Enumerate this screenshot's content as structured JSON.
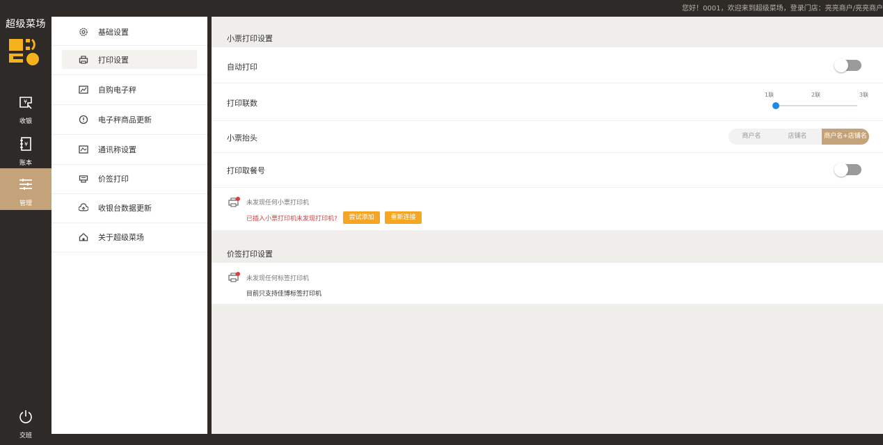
{
  "header": {
    "welcome": "您好！0001，欢迎来到超级菜场，登录门店：亮亮商户/亮亮商户"
  },
  "rail": {
    "brand": "超级菜场",
    "items": [
      {
        "label": "收银",
        "icon": "cashier-icon"
      },
      {
        "label": "账本",
        "icon": "ledger-icon"
      },
      {
        "label": "管理",
        "icon": "sliders-icon"
      }
    ],
    "logout": {
      "label": "交班",
      "icon": "power-icon"
    }
  },
  "menu": {
    "items": [
      {
        "label": "基础设置",
        "icon": "gear-icon"
      },
      {
        "label": "打印设置",
        "icon": "printer-icon"
      },
      {
        "label": "自购电子秤",
        "icon": "scale-icon"
      },
      {
        "label": "电子秤商品更新",
        "icon": "update-icon"
      },
      {
        "label": "通讯称设置",
        "icon": "comm-scale-icon"
      },
      {
        "label": "价签打印",
        "icon": "label-printer-icon"
      },
      {
        "label": "收银台数据更新",
        "icon": "cloud-upload-icon"
      },
      {
        "label": "关于超级菜场",
        "icon": "home-icon"
      }
    ],
    "selected": "打印设置"
  },
  "receipt_section": {
    "title": "小票打印设置",
    "auto_print": {
      "label": "自动打印",
      "on": false
    },
    "copies": {
      "label": "打印联数",
      "options": [
        "1联",
        "2联",
        "3联"
      ],
      "value": "1联"
    },
    "header": {
      "label": "小票抬头",
      "options": [
        "商户名",
        "店铺名",
        "商户名+店铺名"
      ],
      "selected": "商户名+店铺名"
    },
    "pickup_no": {
      "label": "打印取餐号",
      "on": false
    },
    "status": "未发现任何小票打印机",
    "warning": "已插入小票打印机未发现打印机?",
    "try_add": "尝试添加",
    "reconnect": "重新连接"
  },
  "label_section": {
    "title": "价签打印设置",
    "status": "未发现任何标签打印机",
    "note": "目前只支持佳博标签打印机"
  },
  "colors": {
    "accent": "#c4a37a",
    "orange": "#f5a623",
    "blue": "#1e88e5",
    "dark": "#2d2a27"
  }
}
